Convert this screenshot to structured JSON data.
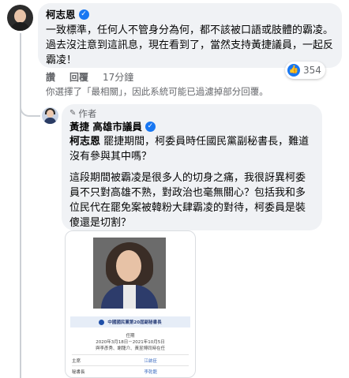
{
  "comment": {
    "author": "柯志恩",
    "text": "一致標準，任何人不管身分為何，都不該被口語或肢體的霸凌。過去沒注意到這訊息，現在看到了，當然支持黃捷議員，一起反霸凌！",
    "actions": {
      "like": "讚",
      "reply": "回覆",
      "time": "17分鐘"
    },
    "reaction_count": "354",
    "filter_note": "你選擇了「最相關」，因此系統可能已過濾掉部分回覆。"
  },
  "reply": {
    "badge": "作者",
    "author": "黃捷 高雄市議員",
    "mention": "柯志恩",
    "paragraph1": "罷捷期間，柯委員時任國民黨副秘書長，難道沒有參與其中嗎？",
    "paragraph2": "這段期間被霸凌是很多人的切身之痛，我很訝異柯委員不只對高雄不熟，對政治也毫無關心？包括我和多位民代在罷免案被韓粉大肆霸凌的對待，柯委員是裝傻還是切割？"
  },
  "attachment": {
    "band_title": "中國國民黨第20屆副秘書長",
    "term_label": "任期",
    "term_dates": "2020年3月18日－2021年10月5日",
    "term_note": "與李彥秀、謝龍介、黃昱博同時在任",
    "rows": [
      {
        "label": "主席",
        "value": "江啟臣"
      },
      {
        "label": "秘書長",
        "value": "李乾龍"
      }
    ]
  },
  "colors": {
    "accent": "#1877f2",
    "bubble": "#f0f2f5",
    "muted": "#65676b"
  }
}
